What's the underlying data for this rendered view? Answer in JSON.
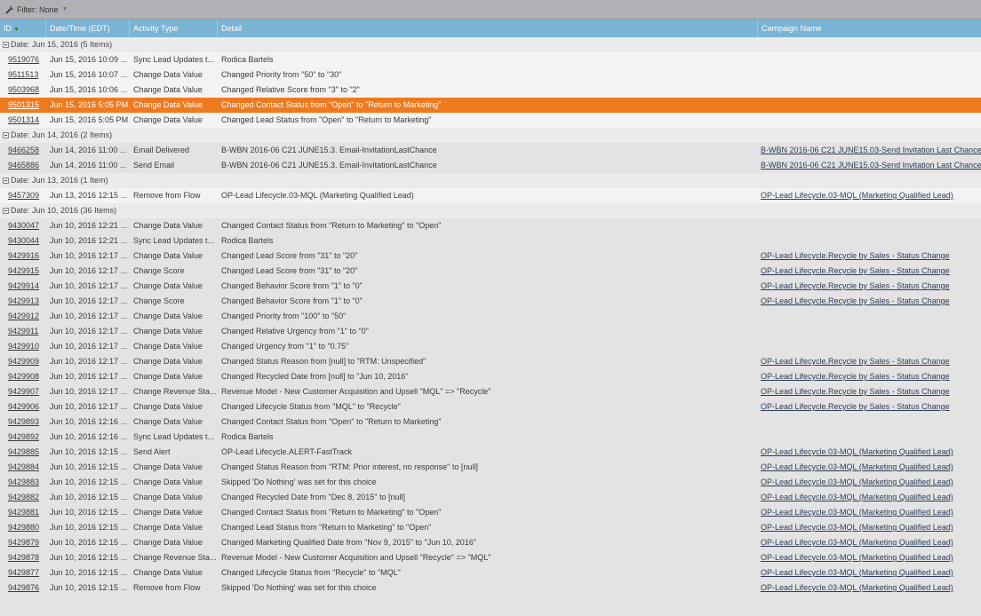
{
  "filter": {
    "label": "Filter: None"
  },
  "columns": {
    "id": "ID",
    "datetime": "Date/Time (EDT)",
    "type": "Activity Type",
    "detail": "Detail",
    "campaign": "Campaign Name"
  },
  "colors": {
    "header": "#7ab3d4",
    "selected": "#ee7a20"
  },
  "groups": [
    {
      "label": "Date: Jun 15, 2016 (5 Items)",
      "shade": "light",
      "rows": [
        {
          "id": "9519076",
          "date": "Jun 15, 2016 10:09 ...",
          "type": "Sync Lead Updates t...",
          "detail": "Rodica Bartels",
          "campaign": ""
        },
        {
          "id": "9511513",
          "date": "Jun 15, 2016 10:07 ...",
          "type": "Change Data Value",
          "detail": "Changed Priority from \"50\" to \"30\"",
          "campaign": ""
        },
        {
          "id": "9503968",
          "date": "Jun 15, 2016 10:06 ...",
          "type": "Change Data Value",
          "detail": "Changed Relative Score from \"3\" to \"2\"",
          "campaign": ""
        },
        {
          "id": "9501315",
          "date": "Jun 15, 2016 5:05 PM",
          "type": "Change Data Value",
          "detail": "Changed Contact Status from \"Open\" to \"Return to Marketing\"",
          "campaign": "",
          "selected": true
        },
        {
          "id": "9501314",
          "date": "Jun 15, 2016 5:05 PM",
          "type": "Change Data Value",
          "detail": "Changed Lead Status from \"Open\" to \"Return to Marketing\"",
          "campaign": ""
        }
      ]
    },
    {
      "label": "Date: Jun 14, 2016 (2 Items)",
      "shade": "dark",
      "rows": [
        {
          "id": "9466258",
          "date": "Jun 14, 2016 11:00 ...",
          "type": "Email Delivered",
          "detail": "B-WBN 2016-06 C21 JUNE15.3. Email-InvitationLastChance",
          "campaign": "B-WBN 2016-06 C21 JUNE15.03-Send Invitation Last Chance"
        },
        {
          "id": "9465886",
          "date": "Jun 14, 2016 11:00 ...",
          "type": "Send Email",
          "detail": "B-WBN 2016-06 C21 JUNE15.3. Email-InvitationLastChance",
          "campaign": "B-WBN 2016-06 C21 JUNE15.03-Send Invitation Last Chance"
        }
      ]
    },
    {
      "label": "Date: Jun 13, 2016 (1 Item)",
      "shade": "light",
      "rows": [
        {
          "id": "9457309",
          "date": "Jun 13, 2016 12:15 ...",
          "type": "Remove from Flow",
          "detail": "OP-Lead Lifecycle.03-MQL (Marketing Qualified Lead)",
          "campaign": "OP-Lead Lifecycle.03-MQL (Marketing Qualified Lead)"
        }
      ]
    },
    {
      "label": "Date: Jun 10, 2016 (36 Items)",
      "shade": "dark",
      "rows": [
        {
          "id": "9430047",
          "date": "Jun 10, 2016 12:21 ...",
          "type": "Change Data Value",
          "detail": "Changed Contact Status from \"Return to Marketing\" to \"Open\"",
          "campaign": ""
        },
        {
          "id": "9430044",
          "date": "Jun 10, 2016 12:21 ...",
          "type": "Sync Lead Updates t...",
          "detail": "Rodica Bartels",
          "campaign": ""
        },
        {
          "id": "9429916",
          "date": "Jun 10, 2016 12:17 ...",
          "type": "Change Data Value",
          "detail": "Changed Lead Score from \"31\" to \"20\"",
          "campaign": "OP-Lead Lifecycle.Recycle by Sales - Status Change"
        },
        {
          "id": "9429915",
          "date": "Jun 10, 2016 12:17 ...",
          "type": "Change Score",
          "detail": "Changed Lead Score from \"31\" to \"20\"",
          "campaign": "OP-Lead Lifecycle.Recycle by Sales - Status Change"
        },
        {
          "id": "9429914",
          "date": "Jun 10, 2016 12:17 ...",
          "type": "Change Data Value",
          "detail": "Changed Behavior Score from \"1\" to \"0\"",
          "campaign": "OP-Lead Lifecycle.Recycle by Sales - Status Change"
        },
        {
          "id": "9429913",
          "date": "Jun 10, 2016 12:17 ...",
          "type": "Change Score",
          "detail": "Changed Behavior Score from \"1\" to \"0\"",
          "campaign": "OP-Lead Lifecycle.Recycle by Sales - Status Change"
        },
        {
          "id": "9429912",
          "date": "Jun 10, 2016 12:17 ...",
          "type": "Change Data Value",
          "detail": "Changed Priority from \"100\" to \"50\"",
          "campaign": ""
        },
        {
          "id": "9429911",
          "date": "Jun 10, 2016 12:17 ...",
          "type": "Change Data Value",
          "detail": "Changed Relative Urgency from \"1\" to \"0\"",
          "campaign": ""
        },
        {
          "id": "9429910",
          "date": "Jun 10, 2016 12:17 ...",
          "type": "Change Data Value",
          "detail": "Changed Urgency from \"1\" to \"0.75\"",
          "campaign": ""
        },
        {
          "id": "9429909",
          "date": "Jun 10, 2016 12:17 ...",
          "type": "Change Data Value",
          "detail": "Changed Status Reason from [null] to \"RTM: Unspecified\"",
          "campaign": "OP-Lead Lifecycle.Recycle by Sales - Status Change"
        },
        {
          "id": "9429908",
          "date": "Jun 10, 2016 12:17 ...",
          "type": "Change Data Value",
          "detail": "Changed Recycled Date from [null] to \"Jun 10, 2016\"",
          "campaign": "OP-Lead Lifecycle.Recycle by Sales - Status Change"
        },
        {
          "id": "9429907",
          "date": "Jun 10, 2016 12:17 ...",
          "type": "Change Revenue Sta...",
          "detail": "Revenue Model - New Customer Acquisition and Upsell \"MQL\" => \"Recycle\"",
          "campaign": "OP-Lead Lifecycle.Recycle by Sales - Status Change"
        },
        {
          "id": "9429906",
          "date": "Jun 10, 2016 12:17 ...",
          "type": "Change Data Value",
          "detail": "Changed Lifecycle Status from \"MQL\" to \"Recycle\"",
          "campaign": "OP-Lead Lifecycle.Recycle by Sales - Status Change"
        },
        {
          "id": "9429893",
          "date": "Jun 10, 2016 12:16 ...",
          "type": "Change Data Value",
          "detail": "Changed Contact Status from \"Open\" to \"Return to Marketing\"",
          "campaign": ""
        },
        {
          "id": "9429892",
          "date": "Jun 10, 2016 12:16 ...",
          "type": "Sync Lead Updates t...",
          "detail": "Rodica Bartels",
          "campaign": ""
        },
        {
          "id": "9429885",
          "date": "Jun 10, 2016 12:15 ...",
          "type": "Send Alert",
          "detail": "OP-Lead Lifecycle.ALERT-FastTrack",
          "campaign": "OP-Lead Lifecycle.03-MQL (Marketing Qualified Lead)"
        },
        {
          "id": "9429884",
          "date": "Jun 10, 2016 12:15 ...",
          "type": "Change Data Value",
          "detail": "Changed Status Reason from \"RTM: Prior interest, no response\" to [null]",
          "campaign": "OP-Lead Lifecycle.03-MQL (Marketing Qualified Lead)"
        },
        {
          "id": "9429883",
          "date": "Jun 10, 2016 12:15 ...",
          "type": "Change Data Value",
          "detail": "Skipped 'Do Nothing' was set for this choice",
          "campaign": "OP-Lead Lifecycle.03-MQL (Marketing Qualified Lead)"
        },
        {
          "id": "9429882",
          "date": "Jun 10, 2016 12:15 ...",
          "type": "Change Data Value",
          "detail": "Changed Recycled Date from \"Dec 8, 2015\" to [null]",
          "campaign": "OP-Lead Lifecycle.03-MQL (Marketing Qualified Lead)"
        },
        {
          "id": "9429881",
          "date": "Jun 10, 2016 12:15 ...",
          "type": "Change Data Value",
          "detail": "Changed Contact Status from \"Return to Marketing\" to \"Open\"",
          "campaign": "OP-Lead Lifecycle.03-MQL (Marketing Qualified Lead)"
        },
        {
          "id": "9429880",
          "date": "Jun 10, 2016 12:15 ...",
          "type": "Change Data Value",
          "detail": "Changed Lead Status from \"Return to Marketing\" to \"Open\"",
          "campaign": "OP-Lead Lifecycle.03-MQL (Marketing Qualified Lead)"
        },
        {
          "id": "9429879",
          "date": "Jun 10, 2016 12:15 ...",
          "type": "Change Data Value",
          "detail": "Changed Marketing Qualified Date from \"Nov 9, 2015\" to \"Jun 10, 2016\"",
          "campaign": "OP-Lead Lifecycle.03-MQL (Marketing Qualified Lead)"
        },
        {
          "id": "9429878",
          "date": "Jun 10, 2016 12:15 ...",
          "type": "Change Revenue Sta...",
          "detail": "Revenue Model - New Customer Acquisition and Upsell \"Recycle\" => \"MQL\"",
          "campaign": "OP-Lead Lifecycle.03-MQL (Marketing Qualified Lead)"
        },
        {
          "id": "9429877",
          "date": "Jun 10, 2016 12:15 ...",
          "type": "Change Data Value",
          "detail": "Changed Lifecycle Status from \"Recycle\" to \"MQL\"",
          "campaign": "OP-Lead Lifecycle.03-MQL (Marketing Qualified Lead)"
        },
        {
          "id": "9429876",
          "date": "Jun 10, 2016 12:15 ...",
          "type": "Remove from Flow",
          "detail": "Skipped 'Do Nothing' was set for this choice",
          "campaign": "OP-Lead Lifecycle.03-MQL (Marketing Qualified Lead)"
        }
      ]
    }
  ]
}
